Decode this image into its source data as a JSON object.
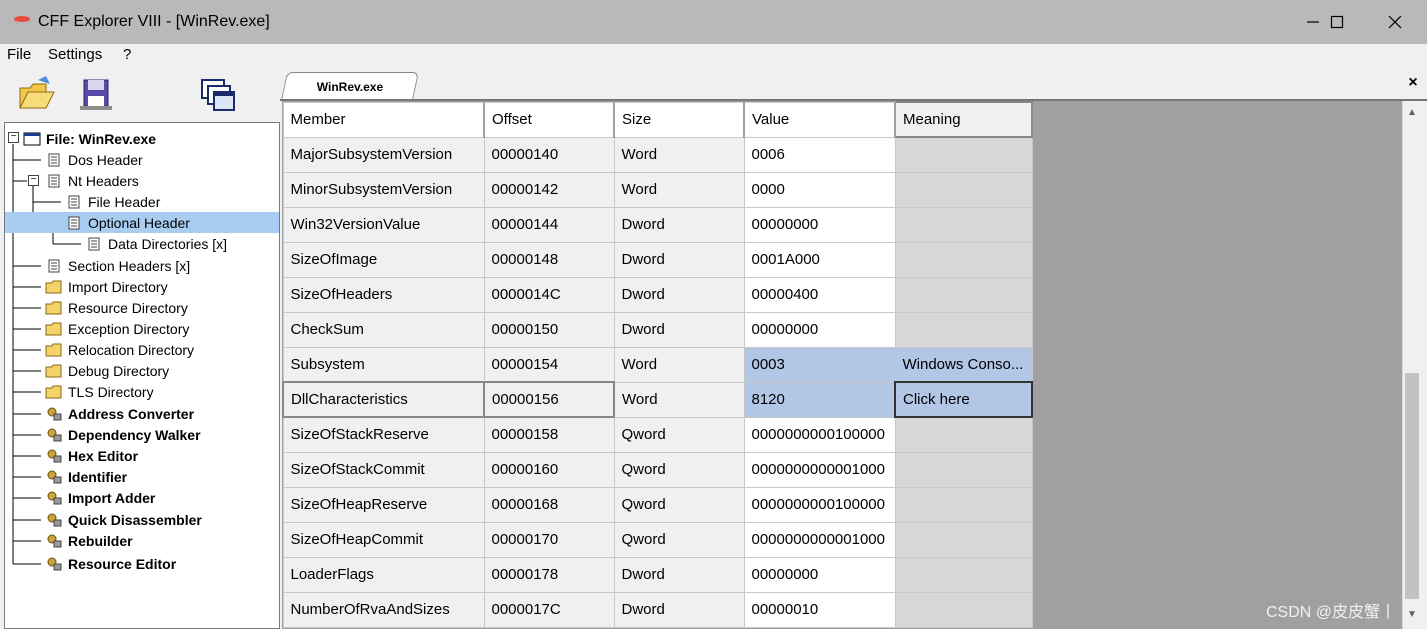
{
  "window": {
    "title": "CFF Explorer VIII - [WinRev.exe]",
    "minimize_icon": "minimize-icon",
    "maximize_icon": "maximize-icon",
    "close_icon": "close-icon"
  },
  "menu": [
    "File",
    "Settings",
    "?"
  ],
  "toolbar": [
    {
      "icon": "open-folder-icon"
    },
    {
      "icon": "save-disk-icon"
    },
    {
      "icon": "windows-icon"
    }
  ],
  "tree": [
    {
      "label": "File: WinRev.exe",
      "icon": "file-window-icon",
      "bold": true
    },
    {
      "label": "Dos Header",
      "icon": "list-icon"
    },
    {
      "label": "Nt Headers",
      "icon": "list-icon"
    },
    {
      "label": "File Header",
      "icon": "list-icon"
    },
    {
      "label": "Optional Header",
      "icon": "list-icon",
      "selected": true
    },
    {
      "label": "Data Directories [x]",
      "icon": "list-icon"
    },
    {
      "label": "Section Headers [x]",
      "icon": "list-icon"
    },
    {
      "label": "Import Directory",
      "icon": "folder-icon"
    },
    {
      "label": "Resource Directory",
      "icon": "folder-icon"
    },
    {
      "label": "Exception Directory",
      "icon": "folder-icon"
    },
    {
      "label": "Relocation Directory",
      "icon": "folder-icon"
    },
    {
      "label": "Debug Directory",
      "icon": "folder-icon"
    },
    {
      "label": "TLS Directory",
      "icon": "folder-icon"
    },
    {
      "label": "Address Converter",
      "icon": "tool-icon",
      "bold": true
    },
    {
      "label": "Dependency Walker",
      "icon": "tool-icon",
      "bold": true
    },
    {
      "label": "Hex Editor",
      "icon": "tool-icon",
      "bold": true
    },
    {
      "label": "Identifier",
      "icon": "tool-icon",
      "bold": true
    },
    {
      "label": "Import Adder",
      "icon": "tool-icon",
      "bold": true
    },
    {
      "label": "Quick Disassembler",
      "icon": "tool-icon",
      "bold": true
    },
    {
      "label": "Rebuilder",
      "icon": "tool-icon",
      "bold": true
    },
    {
      "label": "Resource Editor",
      "icon": "tool-icon",
      "bold": true
    }
  ],
  "tab": {
    "label": "WinRev.exe",
    "close": "×"
  },
  "grid": {
    "columns": [
      "Member",
      "Offset",
      "Size",
      "Value",
      "Meaning"
    ],
    "rows": [
      [
        "MajorSubsystemVersion",
        "00000140",
        "Word",
        "0006",
        ""
      ],
      [
        "MinorSubsystemVersion",
        "00000142",
        "Word",
        "0000",
        ""
      ],
      [
        "Win32VersionValue",
        "00000144",
        "Dword",
        "00000000",
        ""
      ],
      [
        "SizeOfImage",
        "00000148",
        "Dword",
        "0001A000",
        ""
      ],
      [
        "SizeOfHeaders",
        "0000014C",
        "Dword",
        "00000400",
        ""
      ],
      [
        "CheckSum",
        "00000150",
        "Dword",
        "00000000",
        ""
      ],
      [
        "Subsystem",
        "00000154",
        "Word",
        "0003",
        "Windows Conso..."
      ],
      [
        "DllCharacteristics",
        "00000156",
        "Word",
        "8120",
        "Click here"
      ],
      [
        "SizeOfStackReserve",
        "00000158",
        "Qword",
        "0000000000100000",
        ""
      ],
      [
        "SizeOfStackCommit",
        "00000160",
        "Qword",
        "0000000000001000",
        ""
      ],
      [
        "SizeOfHeapReserve",
        "00000168",
        "Qword",
        "0000000000100000",
        ""
      ],
      [
        "SizeOfHeapCommit",
        "00000170",
        "Qword",
        "0000000000001000",
        ""
      ],
      [
        "LoaderFlags",
        "00000178",
        "Dword",
        "00000000",
        ""
      ],
      [
        "NumberOfRvaAndSizes",
        "0000017C",
        "Dword",
        "00000010",
        ""
      ]
    ]
  },
  "watermark": "CSDN @皮皮蟹丨"
}
